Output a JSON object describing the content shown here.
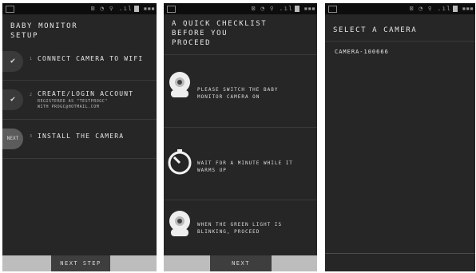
{
  "panel1": {
    "title": "BABY MONITOR\nSETUP",
    "steps": [
      {
        "badge": "✔",
        "number": "1",
        "label": "CONNECT CAMERA TO WIFI"
      },
      {
        "badge": "✔",
        "number": "2",
        "label": "CREATE/LOGIN ACCOUNT",
        "sub": "REGISTERED AS \"TESTPROGC\"\nWITH PROGC@HOTMAIL.COM"
      },
      {
        "badge": "NEXT",
        "number": "3",
        "label": "INSTALL THE CAMERA"
      }
    ],
    "button": "NEXT STEP"
  },
  "panel2": {
    "title": "A QUICK CHECKLIST\nBEFORE YOU\nPROCEED",
    "items": [
      {
        "icon": "camera-icon",
        "text": "PLEASE SWITCH THE BABY\nMONITOR CAMERA ON"
      },
      {
        "icon": "timer-icon",
        "text": "WAIT FOR A MINUTE WHILE IT\nWARMS UP"
      },
      {
        "icon": "camera-light-icon",
        "text": "WHEN THE GREEN LIGHT IS\nBLINKING, PROCEED"
      }
    ],
    "button": "NEXT"
  },
  "panel3": {
    "title": "SELECT A CAMERA",
    "cameras": [
      "CAMERA-100666"
    ]
  },
  "colors": {
    "background": "#262626",
    "text": "#e6e6e6",
    "bar": "#bdbdbd",
    "button": "#3e3e3e"
  }
}
